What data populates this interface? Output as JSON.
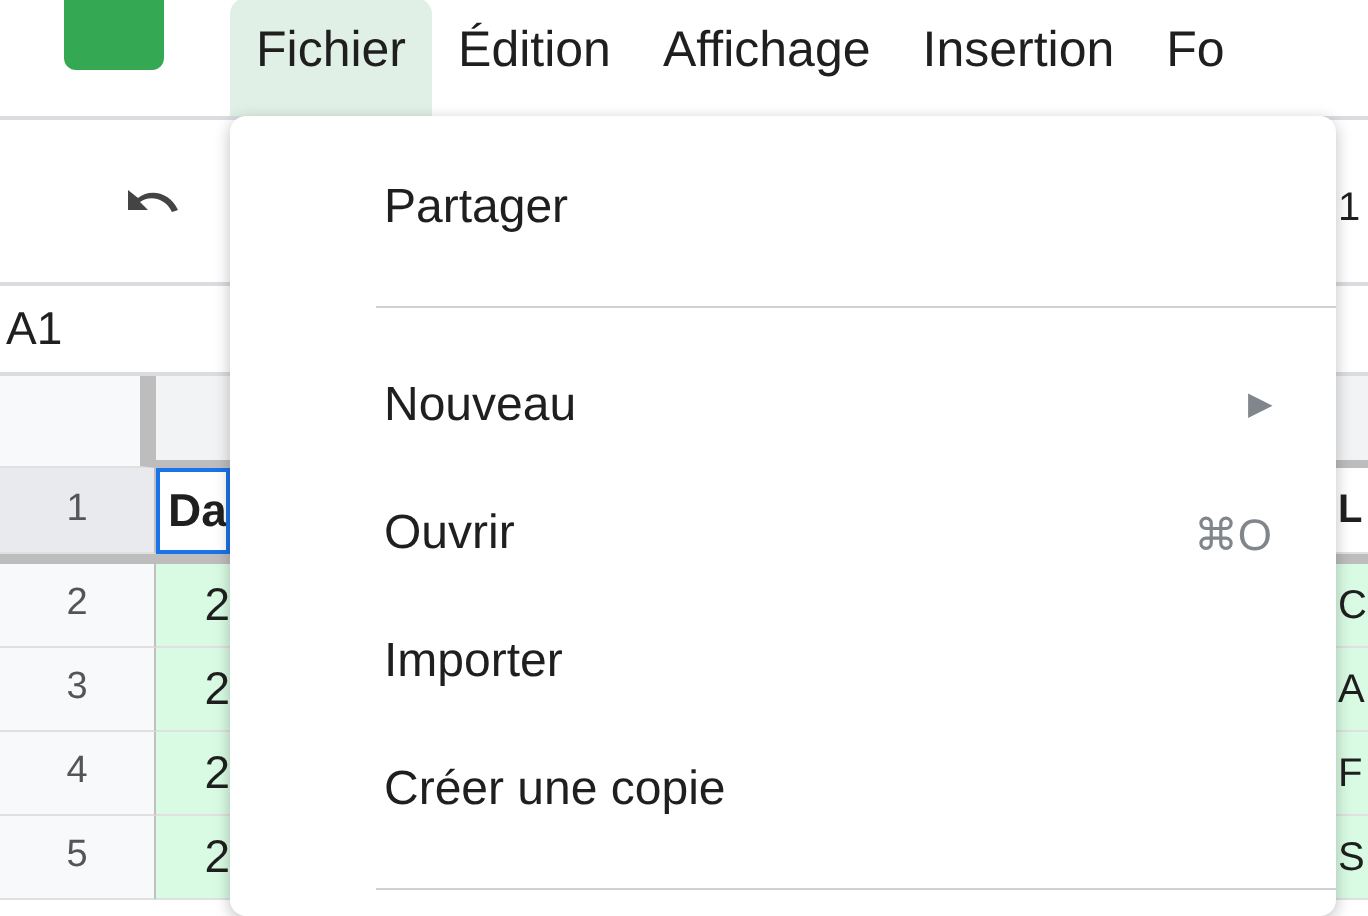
{
  "menu_bar": [
    {
      "label": "Fichier",
      "selected": true
    },
    {
      "label": "Édition",
      "selected": false
    },
    {
      "label": "Affichage",
      "selected": false
    },
    {
      "label": "Insertion",
      "selected": false
    },
    {
      "label": "Fo",
      "selected": false
    }
  ],
  "toolbar": {
    "trailing_text": "1"
  },
  "name_box": "A1",
  "grid": {
    "rows": [
      {
        "number": "1",
        "column_a": "Da",
        "column_c": "L",
        "header": true
      },
      {
        "number": "2",
        "column_a": "2",
        "column_c": "C",
        "header": false
      },
      {
        "number": "3",
        "column_a": "2",
        "column_c": "A",
        "header": false
      },
      {
        "number": "4",
        "column_a": "2",
        "column_c": "F",
        "header": false
      },
      {
        "number": "5",
        "column_a": "2",
        "column_c": "S",
        "header": false
      }
    ]
  },
  "file_menu": [
    {
      "kind": "item",
      "label": "Partager"
    },
    {
      "kind": "separator"
    },
    {
      "kind": "item",
      "label": "Nouveau",
      "submenu": "▶"
    },
    {
      "kind": "item",
      "label": "Ouvrir",
      "shortcut": "⌘O"
    },
    {
      "kind": "item",
      "label": "Importer"
    },
    {
      "kind": "item",
      "label": "Créer une copie"
    },
    {
      "kind": "separator"
    }
  ]
}
